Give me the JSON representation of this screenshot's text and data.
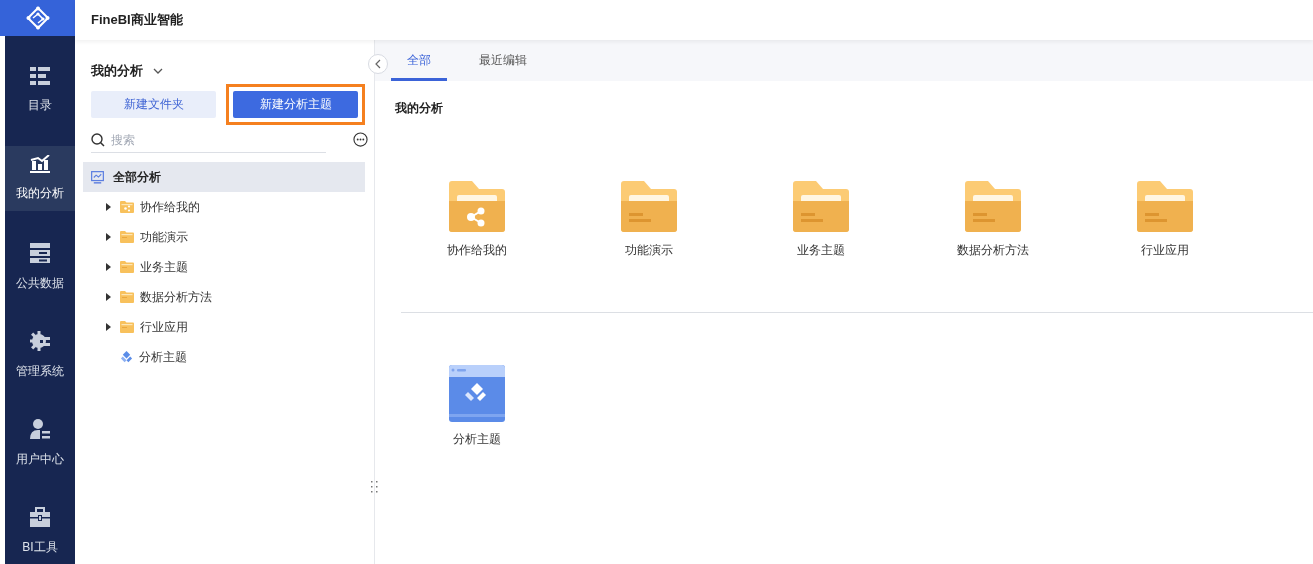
{
  "app": {
    "title": "FineBI商业智能"
  },
  "nav": [
    {
      "label": "目录",
      "kind": "catalog",
      "selected": false
    },
    {
      "label": "我的分析",
      "kind": "analysis",
      "selected": true
    },
    {
      "label": "公共数据",
      "kind": "data",
      "selected": false
    },
    {
      "label": "管理系统",
      "kind": "system",
      "selected": false
    },
    {
      "label": "用户中心",
      "kind": "user",
      "selected": false
    },
    {
      "label": "BI工具",
      "kind": "tools",
      "selected": false
    }
  ],
  "panel": {
    "title": "我的分析",
    "buttons": [
      {
        "label": "新建文件夹",
        "kind": "secondary",
        "highlighted": false
      },
      {
        "label": "新建分析主题",
        "kind": "primary",
        "highlighted": true
      }
    ],
    "search": {
      "placeholder": "搜索"
    },
    "tree": [
      {
        "label": "全部分析",
        "kind": "all",
        "selected": true,
        "children": [
          {
            "label": "协作给我的",
            "kind": "shared",
            "expanded": false,
            "selected": false
          },
          {
            "label": "功能演示",
            "kind": "folder",
            "expanded": false,
            "selected": false
          },
          {
            "label": "业务主题",
            "kind": "folder",
            "expanded": false,
            "selected": false
          },
          {
            "label": "数据分析方法",
            "kind": "folder",
            "expanded": false,
            "selected": false
          },
          {
            "label": "行业应用",
            "kind": "folder",
            "expanded": false,
            "selected": false
          },
          {
            "label": "分析主题",
            "kind": "subject",
            "selected": false
          }
        ]
      }
    ]
  },
  "tabs": [
    {
      "label": "全部",
      "selected": true
    },
    {
      "label": "最近编辑",
      "selected": false
    }
  ],
  "section_title": "我的分析",
  "folders": [
    {
      "label": "协作给我的",
      "kind": "shared"
    },
    {
      "label": "功能演示",
      "kind": "folder"
    },
    {
      "label": "业务主题",
      "kind": "folder"
    },
    {
      "label": "数据分析方法",
      "kind": "folder"
    },
    {
      "label": "行业应用",
      "kind": "folder"
    }
  ],
  "subjects": [
    {
      "label": "分析主题",
      "kind": "subject"
    }
  ]
}
